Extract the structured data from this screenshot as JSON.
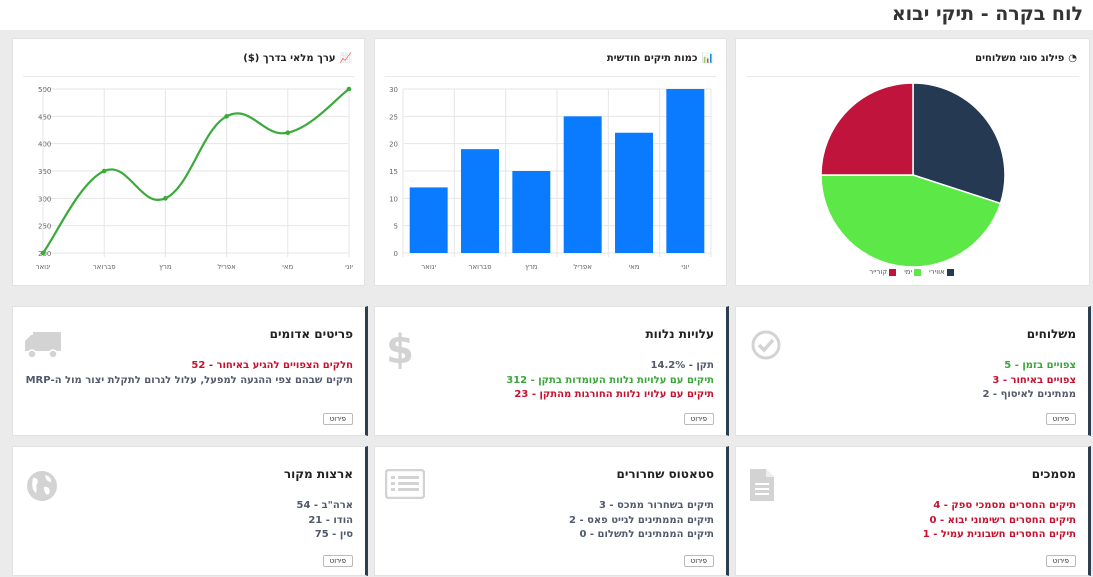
{
  "page": {
    "title": "לוח בקרה - תיקי יבוא"
  },
  "panels": {
    "pie": {
      "title": "פילוג סוגי משלוחים"
    },
    "bar": {
      "title": "כמות תיקים חודשית"
    },
    "line": {
      "title": "ערך מלאי בדרך ($)"
    }
  },
  "chart_data": [
    {
      "type": "pie",
      "title": "פילוג סוגי משלוחים",
      "categories": [
        "אווירי",
        "ימי",
        "קורייר"
      ],
      "values": [
        30,
        45,
        25
      ],
      "colors": [
        "#253a52",
        "#5ce846",
        "#c0143c"
      ],
      "legend_position": "bottom"
    },
    {
      "type": "bar",
      "title": "כמות תיקים חודשית",
      "categories": [
        "ינואר",
        "פברואר",
        "מרץ",
        "אפריל",
        "מאי",
        "יוני"
      ],
      "values": [
        12,
        19,
        15,
        25,
        22,
        30
      ],
      "ylim": [
        0,
        30
      ],
      "yticks": [
        0,
        5,
        10,
        15,
        20,
        25,
        30
      ],
      "color": "#0a7bff",
      "grid": true
    },
    {
      "type": "line",
      "title": "ערך מלאי בדרך ($)",
      "categories": [
        "ינואר",
        "פברואר",
        "מרץ",
        "אפריל",
        "מאי",
        "יוני"
      ],
      "values": [
        200,
        350,
        300,
        450,
        420,
        500
      ],
      "ylim": [
        200,
        500
      ],
      "yticks": [
        200,
        250,
        300,
        350,
        400,
        450,
        500
      ],
      "color": "#3aaa3a",
      "grid": true
    }
  ],
  "cards": {
    "shipments": {
      "title": "משלוחים",
      "lines": [
        "צפויים בזמן - 5",
        "צפויים באיחור - 3",
        "ממתינים לאיסוף - 2"
      ],
      "button": "פירוט",
      "icon": "check-circle-icon"
    },
    "costs": {
      "title": "עלויות נלוות",
      "lines": [
        "תקן - 14.2%",
        "תיקים עם עלויות נלוות העומדות בתקן - 312",
        "תיקים עם עלויו נלוות החורגות מהתקן - 23"
      ],
      "button": "פירוט",
      "icon": "dollar-icon"
    },
    "red_items": {
      "title": "פריטים אדומים",
      "lines": [
        "חלקים הצפויים להגיע באיחור - 52",
        "תיקים שבהם צפי ההגעה למפעל, עלול לגרום לתקלת יצור מול ה-MRP"
      ],
      "button": "פירוט",
      "icon": "truck-icon"
    },
    "documents": {
      "title": "מסמכים",
      "lines": [
        "תיקים החסרים מסמכי ספק - 4",
        "תיקים החסרים רשימוני יבוא - 0",
        "תיקים החסרים חשבונית עמיל - 1"
      ],
      "button": "פירוט",
      "icon": "document-icon"
    },
    "release": {
      "title": "סטאטוס שחרורים",
      "lines": [
        "תיקים בשחרור ממכס - 3",
        "תיקים הממתינים לגייט פאס - 2",
        "תיקים הממתינים לתשלום - 0"
      ],
      "button": "פירוט",
      "icon": "list-icon"
    },
    "origin": {
      "title": "ארצות מקור",
      "lines": [
        "ארה\"ב - 54",
        "הודו - 21",
        "סין - 75"
      ],
      "button": "פירוט",
      "icon": "globe-icon"
    }
  },
  "colors": {
    "card_accent": "#2c3e50",
    "green": "#3aa63a",
    "red": "#c8102e",
    "gray": "#51596a"
  }
}
